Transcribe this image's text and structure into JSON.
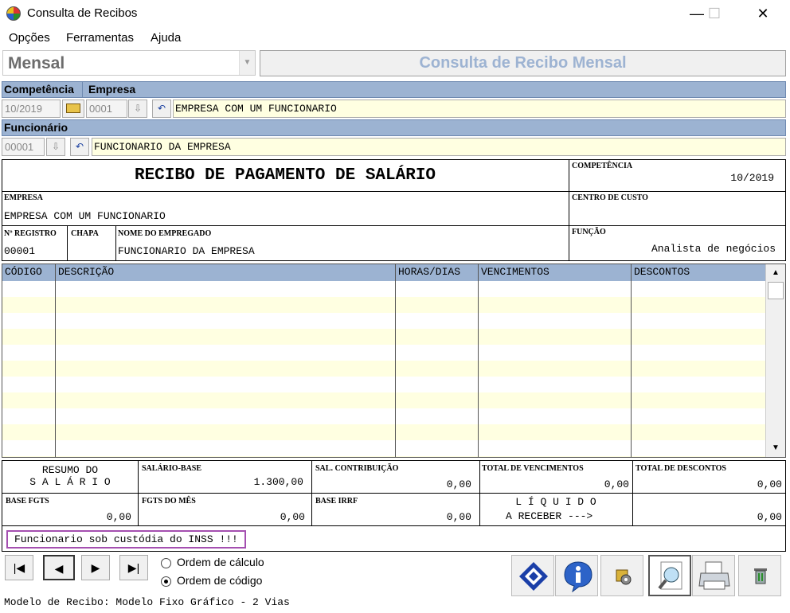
{
  "window": {
    "title": "Consulta de Recibos",
    "minimize": "—",
    "maximize": "☐",
    "close": "✕"
  },
  "menu": [
    "Opções",
    "Ferramentas",
    "Ajuda"
  ],
  "mode": {
    "selected": "Mensal"
  },
  "header_title": "Consulta de Recibo Mensal",
  "labels": {
    "competencia": "Competência",
    "empresa": "Empresa",
    "funcionario": "Funcionário"
  },
  "fields": {
    "competencia": "10/2019",
    "empresa_code": "0001",
    "empresa_name": "EMPRESA COM UM FUNCIONARIO",
    "funcionario_code": "00001",
    "funcionario_name": "FUNCIONARIO DA EMPRESA"
  },
  "receipt": {
    "title": "RECIBO DE PAGAMENTO DE SALÁRIO",
    "competencia_label": "COMPETÊNCIA",
    "competencia_value": "10/2019",
    "empresa_label": "EMPRESA",
    "empresa_value": "EMPRESA COM UM FUNCIONARIO",
    "centro_label": "CENTRO DE CUSTO",
    "registro_label": "Nº REGISTRO",
    "registro_value": "00001",
    "chapa_label": "CHAPA",
    "nome_label": "NOME DO EMPREGADO",
    "nome_value": "FUNCIONARIO DA EMPRESA",
    "funcao_label": "FUNÇÃO",
    "funcao_value": "Analista de negócios"
  },
  "grid": {
    "columns": [
      "CÓDIGO",
      "DESCRIÇÃO",
      "HORAS/DIAS",
      "VENCIMENTOS",
      "DESCONTOS"
    ]
  },
  "summary": {
    "resumo_line1": "RESUMO DO",
    "resumo_line2": "S A L Á R I O",
    "salario_base_label": "SALÁRIO-BASE",
    "salario_base_value": "1.300,00",
    "sal_contrib_label": "SAL. CONTRIBUIÇÃO",
    "sal_contrib_value": "0,00",
    "total_venc_label": "TOTAL DE VENCIMENTOS",
    "total_venc_value": "0,00",
    "total_desc_label": "TOTAL DE DESCONTOS",
    "total_desc_value": "0,00",
    "base_fgts_label": "BASE FGTS",
    "base_fgts_value": "0,00",
    "fgts_mes_label": "FGTS DO MÊS",
    "fgts_mes_value": "0,00",
    "base_irrf_label": "BASE IRRF",
    "base_irrf_value": "0,00",
    "liquido_line1": "L Í Q U I D O",
    "liquido_line2": "A RECEBER --->",
    "liquido_value": "0,00"
  },
  "notice": "Funcionario sob custódia do INSS !!!",
  "order": {
    "option1": "Ordem de cálculo",
    "option2": "Ordem de código",
    "selected": "Ordem de código"
  },
  "status": "Modelo de Recibo: Modelo Fixo Gráfico - 2 Vias",
  "icons": {
    "first": "first-record-icon",
    "prev": "previous-record-icon",
    "next": "next-record-icon",
    "last": "last-record-icon"
  }
}
